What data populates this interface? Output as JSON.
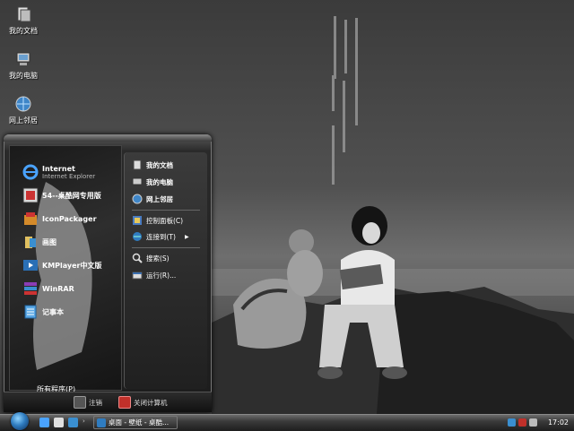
{
  "desktop": {
    "icons": [
      {
        "label": "我的文档",
        "icon": "documents-folder-icon"
      },
      {
        "label": "我的电脑",
        "icon": "computer-icon"
      },
      {
        "label": "网上邻居",
        "icon": "network-icon"
      }
    ]
  },
  "start_menu": {
    "pinned": [
      {
        "title": "Internet",
        "subtitle": "Internet Explorer",
        "icon": "internet-explorer-icon"
      },
      {
        "title": "54--桌酷网专用版",
        "icon": "app-icon"
      },
      {
        "title": "IconPackager",
        "icon": "iconpackager-icon"
      },
      {
        "title": "画图",
        "icon": "paint-icon"
      },
      {
        "title": "KMPlayer中文版",
        "icon": "media-player-icon"
      },
      {
        "title": "WinRAR",
        "icon": "winrar-icon"
      },
      {
        "title": "记事本",
        "icon": "notepad-icon"
      }
    ],
    "all_programs": "所有程序(P)",
    "right": [
      {
        "label": "我的文档",
        "icon": "documents-folder-icon",
        "bold": true
      },
      {
        "label": "我的电脑",
        "icon": "computer-icon",
        "bold": true
      },
      {
        "label": "网上邻居",
        "icon": "network-icon",
        "bold": true
      },
      {
        "label": "控制面板(C)",
        "icon": "control-panel-icon"
      },
      {
        "label": "连接到(T)",
        "icon": "connect-icon",
        "arrow": "▶"
      },
      {
        "label": "搜索(S)",
        "icon": "search-icon"
      },
      {
        "label": "运行(R)...",
        "icon": "run-icon"
      }
    ],
    "logoff": "注销",
    "shutdown": "关闭计算机"
  },
  "taskbar": {
    "task_label": "桌面 - 壁纸 - 桌酷...",
    "clock": "17:02"
  },
  "colors": {
    "accent": "#2f7cc0",
    "shutdown": "#c0302a"
  }
}
